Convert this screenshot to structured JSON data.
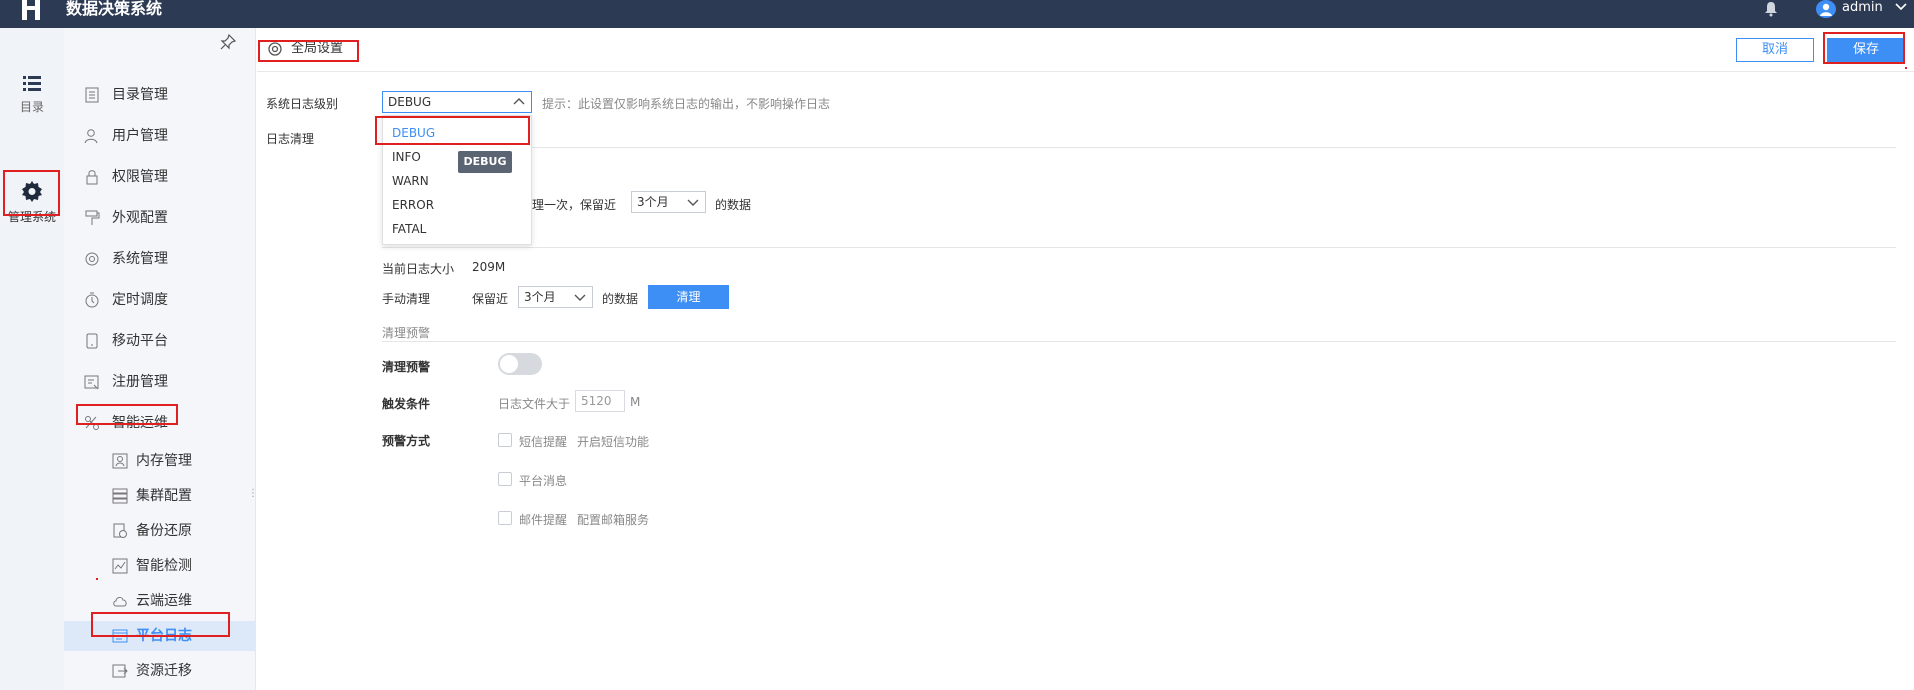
{
  "app": {
    "title": "数据决策系统",
    "user": "admin"
  },
  "rail": [
    {
      "label": "目录",
      "icon": "list-icon"
    },
    {
      "label": "管理系统",
      "icon": "gear-icon"
    }
  ],
  "menu": {
    "items": [
      {
        "label": "目录管理",
        "icon": "catalog-icon"
      },
      {
        "label": "用户管理",
        "icon": "user-icon"
      },
      {
        "label": "权限管理",
        "icon": "lock-icon"
      },
      {
        "label": "外观配置",
        "icon": "brush-icon"
      },
      {
        "label": "系统管理",
        "icon": "settings-icon"
      },
      {
        "label": "定时调度",
        "icon": "timer-icon"
      },
      {
        "label": "移动平台",
        "icon": "mobile-icon"
      },
      {
        "label": "注册管理",
        "icon": "register-icon"
      },
      {
        "label": "智能运维",
        "icon": "ops-icon"
      }
    ],
    "sub_items": [
      {
        "label": "内存管理",
        "icon": "memory-icon"
      },
      {
        "label": "集群配置",
        "icon": "cluster-icon"
      },
      {
        "label": "备份还原",
        "icon": "backup-icon"
      },
      {
        "label": "智能检测",
        "icon": "detect-icon"
      },
      {
        "label": "云端运维",
        "icon": "cloud-icon"
      },
      {
        "label": "平台日志",
        "icon": "log-icon",
        "active": true
      },
      {
        "label": "资源迁移",
        "icon": "migrate-icon"
      }
    ]
  },
  "header": {
    "tab": "全局设置",
    "cancel": "取消",
    "save": "保存"
  },
  "form": {
    "log_level_label": "系统日志级别",
    "log_level_value": "DEBUG",
    "log_level_hint": "提示：此设置仅影响系统日志的输出，不影响操作日志",
    "log_clean_label": "日志清理",
    "auto_clean_partial": "清理一次，保留近",
    "auto_keep": "3个月",
    "of_data": "的数据",
    "current_size_label": "当前日志大小",
    "current_size_value": "209M",
    "manual_clean_label": "手动清理",
    "keep_recent": "保留近",
    "manual_keep": "3个月",
    "clear_button": "清理",
    "warning_section": "清理预警",
    "warning_label": "清理预警",
    "warning_enabled": false,
    "trigger_label": "触发条件",
    "trigger_text": "日志文件大于",
    "trigger_value": "5120",
    "trigger_unit": "M",
    "method_label": "预警方式",
    "sms_label": "短信提醒",
    "sms_link": "开启短信功能",
    "platform_msg_label": "平台消息",
    "email_label": "邮件提醒",
    "email_link": "配置邮箱服务"
  },
  "dropdown": {
    "options": [
      "DEBUG",
      "INFO",
      "WARN",
      "ERROR",
      "FATAL"
    ],
    "selected": "DEBUG",
    "tooltip": "DEBUG"
  },
  "colors": {
    "topbar": "#2c3a54",
    "accent": "#3d8ef5",
    "annotation": "#e02020"
  }
}
